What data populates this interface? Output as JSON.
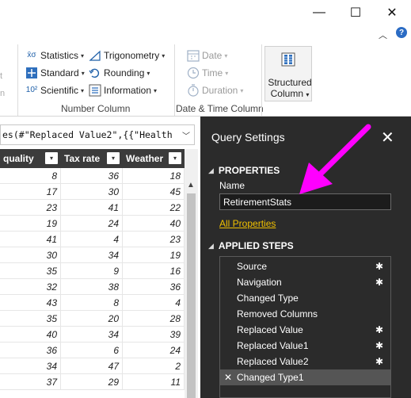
{
  "ribbon": {
    "groups": {
      "number_column": "Number Column",
      "date_time_column": "Date & Time Column"
    },
    "partial_left": [
      "t",
      "n"
    ],
    "items": {
      "statistics": "Statistics",
      "trigonometry": "Trigonometry",
      "standard": "Standard",
      "rounding": "Rounding",
      "scientific": "Scientific",
      "information": "Information",
      "date": "Date",
      "time": "Time",
      "duration": "Duration",
      "structured_column": [
        "Structured",
        "Column"
      ]
    },
    "icon_texts": {
      "statistics": "x̄σ",
      "scientific": "10²"
    }
  },
  "formula_bar": {
    "text": "es(#\"Replaced Value2\",{{\"Health"
  },
  "grid": {
    "columns": [
      "quality",
      "Tax rate",
      "Weather"
    ],
    "rows": [
      [
        8,
        36,
        18
      ],
      [
        17,
        30,
        45
      ],
      [
        23,
        41,
        22
      ],
      [
        19,
        24,
        40
      ],
      [
        41,
        4,
        23
      ],
      [
        30,
        34,
        19
      ],
      [
        35,
        9,
        16
      ],
      [
        32,
        38,
        36
      ],
      [
        43,
        8,
        4
      ],
      [
        35,
        20,
        28
      ],
      [
        40,
        34,
        39
      ],
      [
        36,
        6,
        24
      ],
      [
        34,
        47,
        2
      ],
      [
        37,
        29,
        11
      ]
    ]
  },
  "query_settings": {
    "title": "Query Settings",
    "properties_header": "PROPERTIES",
    "name_label": "Name",
    "name_value": "RetirementStats",
    "all_properties_link": "All Properties",
    "applied_steps_header": "APPLIED STEPS",
    "steps": [
      {
        "label": "Source",
        "gear": true,
        "selected": false
      },
      {
        "label": "Navigation",
        "gear": true,
        "selected": false
      },
      {
        "label": "Changed Type",
        "gear": false,
        "selected": false
      },
      {
        "label": "Removed Columns",
        "gear": false,
        "selected": false
      },
      {
        "label": "Replaced Value",
        "gear": true,
        "selected": false
      },
      {
        "label": "Replaced Value1",
        "gear": true,
        "selected": false
      },
      {
        "label": "Replaced Value2",
        "gear": true,
        "selected": false
      },
      {
        "label": "Changed Type1",
        "gear": false,
        "selected": true
      }
    ]
  },
  "colors": {
    "pane_bg": "#2b2b2b",
    "grid_header_bg": "#3b3b3b",
    "link": "#f0c000",
    "annotation_arrow": "#ff00ff"
  },
  "icons": {
    "window": [
      "minimize-icon",
      "maximize-icon",
      "close-icon"
    ],
    "ribbon_collapse": "chevron-up-icon",
    "help": "help-icon",
    "step_settings": "gear-icon",
    "step_delete": "delete-icon"
  },
  "glyphs": {
    "minimize": "—",
    "maximize": "☐",
    "close": "✕",
    "chevron_up": "︿",
    "help": "?",
    "caret": "▾",
    "triangle": "◢",
    "gear": "✱",
    "delete": "✕",
    "pane_close": "✕",
    "scroll_up": "▲",
    "filter": "▾",
    "formula_chevron": "﹀"
  }
}
